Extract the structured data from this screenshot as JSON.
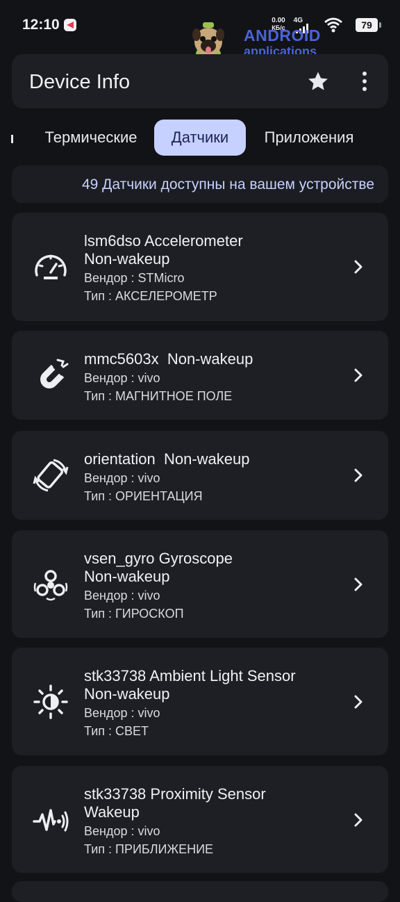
{
  "status_bar": {
    "time": "12:10",
    "net_speed_value": "0.00",
    "net_speed_unit": "КБ/с",
    "net_type": "4G",
    "battery": "79"
  },
  "watermark": {
    "title": "ANDROID",
    "subtitle": "applications"
  },
  "app_bar": {
    "title": "Device Info",
    "star_icon": "star-icon",
    "more_icon": "more-vert-icon"
  },
  "tabs": [
    {
      "label": "Термические",
      "active": false
    },
    {
      "label": "Датчики",
      "active": true
    },
    {
      "label": "Приложения",
      "active": false
    }
  ],
  "sensor_count_text": "49 Датчики доступны на вашем устройстве",
  "sensors": [
    {
      "name": "lsm6dso Accelerometer\nNon-wakeup",
      "vendor": "Вендор : STMicro",
      "type": "Тип : АКСЕЛЕРОМЕТР",
      "icon": "speedometer-icon"
    },
    {
      "name": "mmc5603x  Non-wakeup",
      "vendor": "Вендор : vivo",
      "type": "Тип : МАГНИТНОЕ ПОЛЕ",
      "icon": "magnet-icon"
    },
    {
      "name": "orientation  Non-wakeup",
      "vendor": "Вендор : vivo",
      "type": "Тип : ОРИЕНТАЦИЯ",
      "icon": "screen-rotation-icon"
    },
    {
      "name": "vsen_gyro Gyroscope\nNon-wakeup",
      "vendor": "Вендор : vivo",
      "type": "Тип : ГИРОСКОП",
      "icon": "gyroscope-icon"
    },
    {
      "name": "stk33738 Ambient Light Sensor\nNon-wakeup",
      "vendor": "Вендор : vivo",
      "type": "Тип : СВЕТ",
      "icon": "brightness-icon"
    },
    {
      "name": "stk33738 Proximity Sensor\nWakeup",
      "vendor": "Вендор : vivo",
      "type": "Тип : ПРИБЛИЖЕНИЕ",
      "icon": "proximity-icon"
    }
  ],
  "colors": {
    "background": "#121317",
    "card": "#1d1f24",
    "accent_tab": "#c7d1ff",
    "accent_text": "#c7d1ff",
    "watermark": "#4b63d9"
  }
}
